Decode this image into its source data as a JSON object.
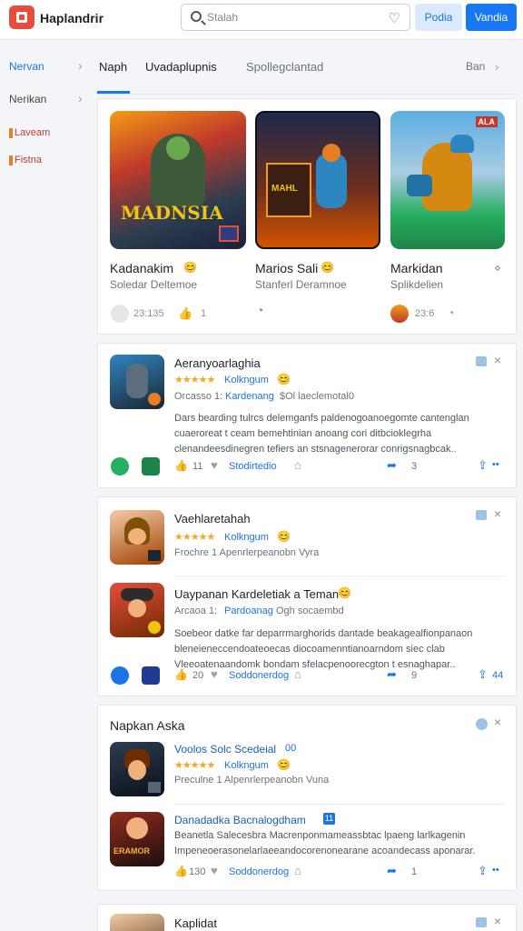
{
  "header": {
    "brand": "Haplandrir",
    "search_placeholder": "Stalah",
    "btn_secondary": "Podia",
    "btn_primary": "Vandia"
  },
  "sidebar": {
    "items": [
      {
        "label": "Nervan",
        "color": "#1877f2"
      },
      {
        "label": "Nerikan",
        "color": "#444444"
      },
      {
        "label": "Laveam",
        "color": "#c0392b"
      },
      {
        "label": "Fistna",
        "color": "#c0392b"
      }
    ]
  },
  "tabs": {
    "items": [
      "Naph",
      "Uvadaplupnis",
      "Spollegclantad"
    ],
    "right": "Ban"
  },
  "featured": [
    {
      "title": "Kadanakim",
      "sub": "Soledar Deltemoe",
      "meta1": "23:135",
      "meta2": "1",
      "art": "MADNSIA"
    },
    {
      "title": "Marios Sali",
      "sub": "Stanferl Deramnoe",
      "meta1": "",
      "meta2": "",
      "art": "MAHL"
    },
    {
      "title": "Markidan",
      "sub": "Splikdelien",
      "meta1": "23:6",
      "meta2": "",
      "art": "ALA"
    }
  ],
  "post1": {
    "title": "Aeranyoarlaghia",
    "rating_link": "Kolkngum",
    "info_prefix": "Orcasso 1:",
    "info_link": "Kardenang",
    "info_rest": "$Ol laeclemotal0",
    "body": "Dars bearding tulrcs delemganfs paldenogoanoegomte cantenglan cuaeroreat t ceam bemehtinian anoang cori ditbcioklegrha clenandeesdinegren tefiers an stsnagenerorar conrigsnagbcak..",
    "likes": "11",
    "reply": "Stodirtedio",
    "shares": "3"
  },
  "post2": {
    "title": "Vaehlaretahah",
    "rating_link": "Kolkngum",
    "info": "Frochre 1 Apenrlerpeanobn Vyra",
    "sub_title": "Uaypanan Kardeletiak a Teman",
    "sub_info_prefix": "Arcaoa 1:",
    "sub_info_link": "Pardoanag",
    "sub_info_rest": "Ogh socaembd",
    "body": "Soebeor datke far deparrmarghorids dantade beakagealfionpanaon bleneieneccendoateoecas diocoamenntianoarndom siec clab Vleeoatenaandomk bondam sfelacpenoorecgton t esnaghapar..",
    "likes": "20",
    "reply": "Soddonerdog",
    "shares": "9",
    "extra": "44"
  },
  "post3": {
    "section": "Napkan Aska",
    "title": "Voolos Solc Scedeial",
    "title_extra": "00",
    "rating_link": "Kolkngum",
    "info": "Preculne 1 Alpenrlerpeanobn Vuna",
    "sub_title": "Danadadka Bacnalogdham",
    "sub_num": "11",
    "body": "Beanetla Salecesbra Macrenponmameassbtac lpaeng larlkagenin Impeneoerasonelarlaeeandocorenonearane acoandecass aponarar.",
    "likes": "130",
    "reply": "Soddonerdog",
    "shares": "1"
  },
  "post4": {
    "title": "Kaplidat"
  },
  "colors": {
    "accent": "#1877f2",
    "star": "#f5a623",
    "link": "#1a73e8"
  }
}
